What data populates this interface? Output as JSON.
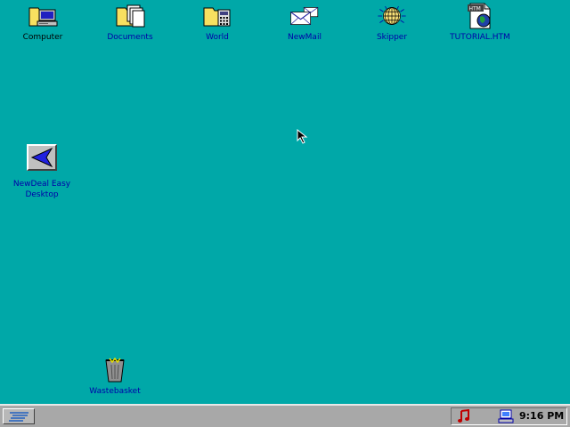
{
  "desktop": {
    "background_color": "#00a8a8",
    "icons": [
      {
        "label": "Computer",
        "icon": "computer-folder-icon"
      },
      {
        "label": "Documents",
        "icon": "documents-folder-icon"
      },
      {
        "label": "World",
        "icon": "world-folder-icon"
      },
      {
        "label": "NewMail",
        "icon": "mail-envelope-icon"
      },
      {
        "label": "Skipper",
        "icon": "globe-icon"
      },
      {
        "label": "TUTORIAL.HTM",
        "icon": "html-file-icon"
      },
      {
        "label_line1": "NewDeal Easy",
        "label_line2": "Desktop",
        "icon": "blue-arrow-icon"
      },
      {
        "label": "Wastebasket",
        "icon": "wastebasket-icon"
      }
    ]
  },
  "taskbar": {
    "start_icon": "start-express-icon",
    "tray": {
      "music_icon": "music-note-icon",
      "computer_icon": "monitor-icon",
      "clock": "9:16 PM"
    }
  }
}
